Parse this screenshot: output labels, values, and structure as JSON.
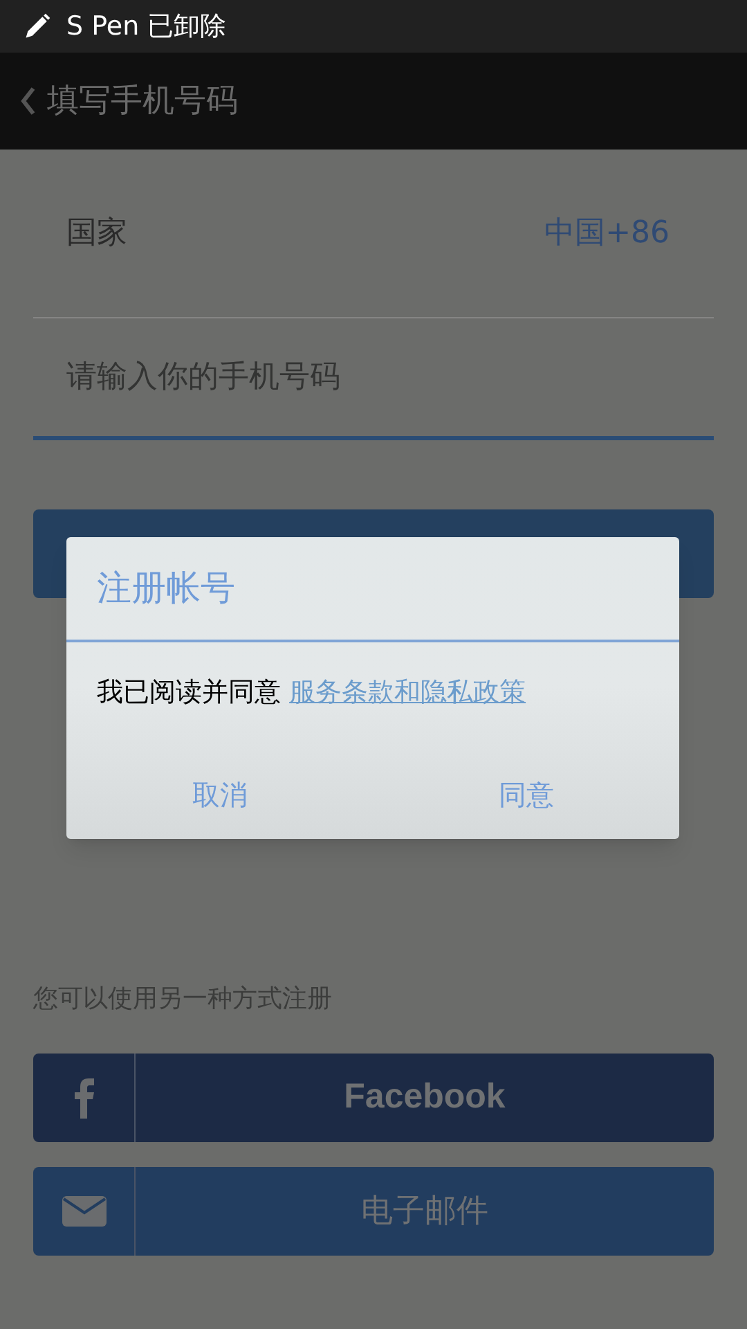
{
  "status_bar": {
    "text": "S Pen 已卸除"
  },
  "header": {
    "title": "填写手机号码"
  },
  "form": {
    "country_label": "国家",
    "country_value": "中国+86",
    "phone_placeholder": "请输入你的手机号码"
  },
  "dialog": {
    "title": "注册帐号",
    "message": "我已阅读并同意",
    "link": "服务条款和隐私政策",
    "buttons": [
      "取消",
      "同意"
    ]
  },
  "alt_signup": {
    "label": "您可以使用另一种方式注册",
    "buttons": [
      {
        "kind": "facebook",
        "label": "Facebook"
      },
      {
        "kind": "email",
        "label": "电子邮件"
      }
    ]
  }
}
